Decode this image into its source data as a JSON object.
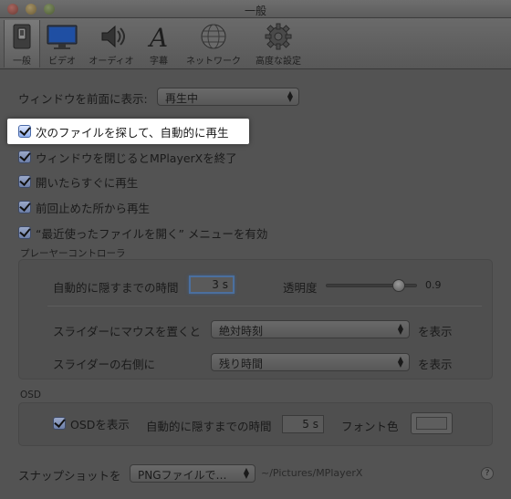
{
  "window": {
    "title": "一般"
  },
  "toolbar": {
    "items": [
      {
        "label": "一般",
        "icon": "general-switch-icon",
        "selected": true
      },
      {
        "label": "ビデオ",
        "icon": "monitor-icon"
      },
      {
        "label": "オーディオ",
        "icon": "speaker-icon"
      },
      {
        "label": "字幕",
        "icon": "font-a-icon"
      },
      {
        "label": "ネットワーク",
        "icon": "globe-icon"
      },
      {
        "label": "高度な設定",
        "icon": "gear-icon"
      }
    ]
  },
  "general": {
    "window_front_label": "ウィンドウを前面に表示:",
    "window_front_value": "再生中",
    "checkboxes": [
      {
        "label": "次のファイルを探して、自動的に再生",
        "checked": true,
        "highlighted": true
      },
      {
        "label": "ウィンドウを閉じるとMPlayerXを終了",
        "checked": true
      },
      {
        "label": "開いたらすぐに再生",
        "checked": true
      },
      {
        "label": "前回止めた所から再生",
        "checked": true
      },
      {
        "label": "“最近使ったファイルを開く” メニューを有効",
        "checked": true
      }
    ]
  },
  "player_controller": {
    "group_title": "プレーヤーコントローラ",
    "autohide_label": "自動的に隠すまでの時間",
    "autohide_value": "3 s",
    "opacity_label": "透明度",
    "opacity_value": "0.9",
    "mouse_over_label": "スライダーにマウスを置くと",
    "mouse_over_value": "絶対時刻",
    "mouse_over_suffix": "を表示",
    "right_side_label": "スライダーの右側に",
    "right_side_value": "残り時間",
    "right_side_suffix": "を表示"
  },
  "osd": {
    "group_title": "OSD",
    "show_label": "OSDを表示",
    "show_checked": true,
    "autohide_label": "自動的に隠すまでの時間",
    "autohide_value": "5 s",
    "font_color_label": "フォント色"
  },
  "snapshot": {
    "label": "スナップショットを",
    "format_value": "PNGファイルで…",
    "path": "~/Pictures/MPlayerX"
  }
}
